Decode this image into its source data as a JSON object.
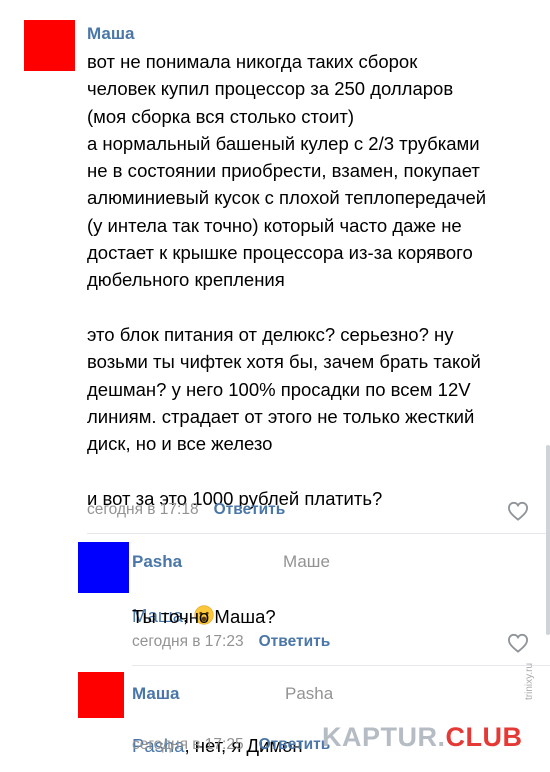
{
  "colors": {
    "link": "#4a76a8",
    "meta": "#939393",
    "avatar_red": "#ff0000",
    "avatar_blue": "#0000ff"
  },
  "comments": [
    {
      "author": "Маша",
      "avatar_color": "#ff0000",
      "text": "вот не понимала никогда таких сборок\nчеловек купил процессор за 250 долларов\n(моя сборка вся столько стоит)\nа нормальный башеный кулер с 2/3 трубками\nне в состоянии приобрести, взамен, покупает\nалюминиевый кусок с плохой теплопередачей\n(у интела так точно) который часто даже не\nдостает к крышке процессора из-за корявого\nдюбельного крепления\n\nэто блок питания от делюкс? серьезно? ну\nвозьми ты чифтек хотя бы, зачем брать такой\nдешман? у него 100% просадки по всем 12V\nлиниям. страдает от этого не только жесткий\nдиск, но и все железо\n\nи вот за это 1000 рублей платить?",
      "time": "сегодня в 17:18",
      "reply_label": "Ответить",
      "like_icon": "heart-outline-icon"
    },
    {
      "author": "Pasha",
      "reply_to": "Маше",
      "avatar_color": "#0000ff",
      "mention": "Маша",
      "after_mention": ",",
      "emoji": "worried-face-emoji",
      "text": "Ты точно Маша?",
      "time": "сегодня в 17:23",
      "reply_label": "Ответить",
      "like_icon": "heart-outline-icon"
    },
    {
      "author": "Маша",
      "reply_to": "Pasha",
      "avatar_color": "#ff0000",
      "mention": "Pasha",
      "text": ", нет, я Димон",
      "time": "сегодня в 17:25",
      "reply_label": "Ответить"
    }
  ],
  "watermark": {
    "part1": "KAPTUR.",
    "part2": "CLUB"
  },
  "site_tag": "trinixy.ru"
}
